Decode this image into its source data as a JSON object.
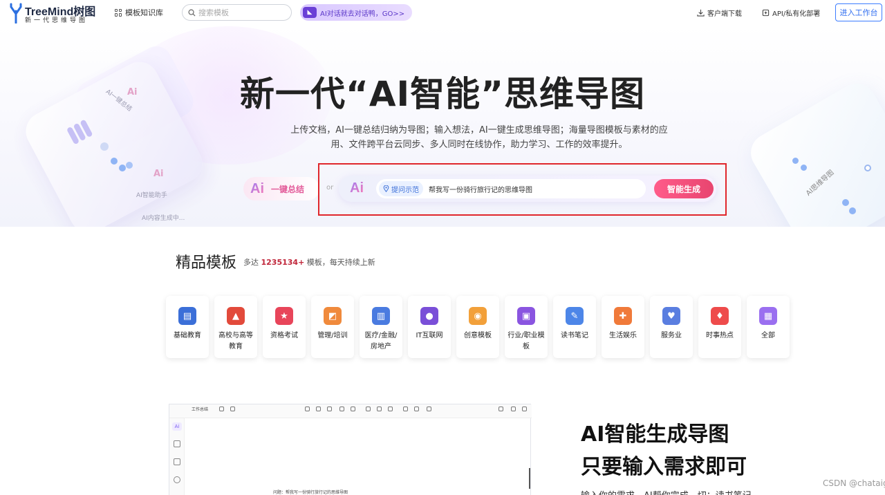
{
  "header": {
    "logo_name": "TreeMind树图",
    "logo_slogan": "新一代思维导图",
    "nav_kb": "模板知识库",
    "search_placeholder": "搜索模板",
    "ai_pill": "AI对话就去对话鸭，GO>>",
    "download": "客户端下载",
    "api": "API/私有化部署",
    "enter": "进入工作台"
  },
  "hero": {
    "title": "新一代“AI智能”思维导图",
    "desc": "上传文档，AI一键总结归纳为导图；输入想法，AI一键生成思维导图；海量导图模板与素材的应用、文件跨平台云同步、多人同时在线协作，助力学习、工作的效率提升。",
    "ai_glyph": "Ai",
    "quick_summary": "一键总结",
    "or": "or",
    "example_chip": "提问示范",
    "input_value": "帮我写一份骑行旅行记的思维导图",
    "generate": "智能生成",
    "deco_left_label1": "AI一键总结",
    "deco_left_label2": "AI智能助手",
    "deco_left_label3": "AI内容生成中...",
    "deco_right_label": "AI思维导图"
  },
  "templates": {
    "title": "精品模板",
    "sub_prefix": "多达",
    "count": "1235134+",
    "sub_suffix": "模板，每天持续上新",
    "items": [
      {
        "label": "基础教育",
        "color": "#3b6fd8"
      },
      {
        "label": "高校与高等教育",
        "color": "#e24a3b"
      },
      {
        "label": "资格考试",
        "color": "#e8455a"
      },
      {
        "label": "管理/培训",
        "color": "#f08a3c"
      },
      {
        "label": "医疗/金融/房地产",
        "color": "#4a7be0"
      },
      {
        "label": "IT互联网",
        "color": "#7a4fd8"
      },
      {
        "label": "创意模板",
        "color": "#f2a03a"
      },
      {
        "label": "行业/职业模板",
        "color": "#8a55e0"
      },
      {
        "label": "读书笔记",
        "color": "#4d86e8"
      },
      {
        "label": "生活娱乐",
        "color": "#f07a3a"
      },
      {
        "label": "服务业",
        "color": "#5a7ee0"
      },
      {
        "label": "时事热点",
        "color": "#ee4b4b"
      },
      {
        "label": "全部",
        "color": "#9a6ff0"
      }
    ]
  },
  "app_preview": {
    "crumb": "工作总结",
    "query": "问题：帮我写一份骑行旅行记的思维导图"
  },
  "feature": {
    "h1": "AI智能生成导图",
    "h2": "只要输入需求即可",
    "desc": "输入你的需求，AI帮你完成，切：读书笔记"
  },
  "watermark": "CSDN @chataigc"
}
